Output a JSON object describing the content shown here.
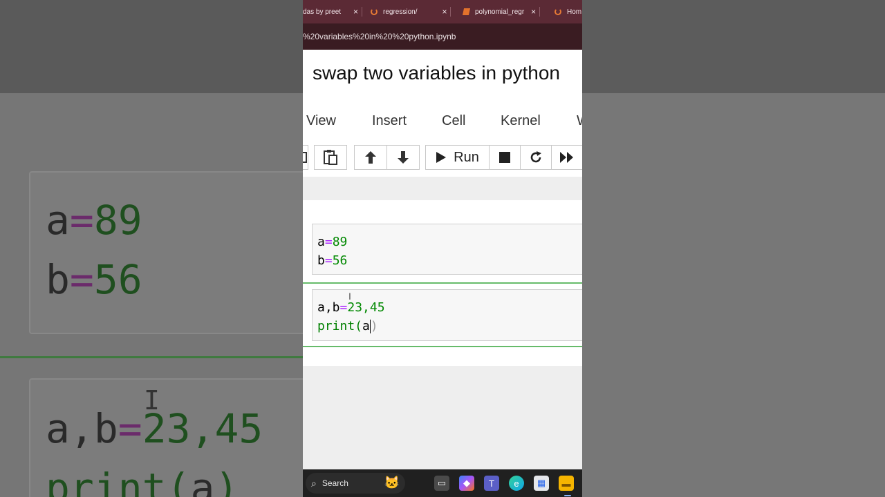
{
  "browser": {
    "tabs": [
      {
        "label": "das by preet",
        "icon": "none"
      },
      {
        "label": "regression/",
        "icon": "jupyter-ring-icon"
      },
      {
        "label": "polynomial_regr",
        "icon": "notebook-icon"
      },
      {
        "label": "Hom",
        "icon": "jupyter-ring-icon"
      }
    ],
    "close_glyph": "×",
    "url": "%20variables%20in%20%20python.ipynb"
  },
  "notebook": {
    "title": "swap two variables in python",
    "menu": [
      "View",
      "Insert",
      "Cell",
      "Kernel",
      "W"
    ],
    "toolbar": {
      "run_label": "Run"
    },
    "cells": [
      {
        "lines": [
          [
            "a",
            "=",
            "89"
          ],
          [
            "b",
            "=",
            "56"
          ]
        ]
      },
      {
        "lines": [
          [
            "a,b",
            "=",
            "23,45"
          ],
          [
            "print(",
            "a",
            ")"
          ]
        ]
      }
    ]
  },
  "background": {
    "code_lines": [
      [
        "a",
        "=",
        "89"
      ],
      [
        "b",
        "=",
        "56"
      ],
      [
        "a,b",
        "=",
        "23,45"
      ],
      [
        "print(",
        "a",
        ")"
      ]
    ]
  },
  "taskbar": {
    "search_label": "Search",
    "apps": [
      "file-explorer-icon",
      "task-view-icon",
      "copilot-icon",
      "teams-icon",
      "edge-icon",
      "store-icon",
      "folder-icon"
    ]
  },
  "colors": {
    "tabbar": "#5b2a35",
    "urlbar": "#3a1c22",
    "operator": "#aa22ff",
    "number": "#008800",
    "selected_cell_border": "#66bb6a"
  }
}
